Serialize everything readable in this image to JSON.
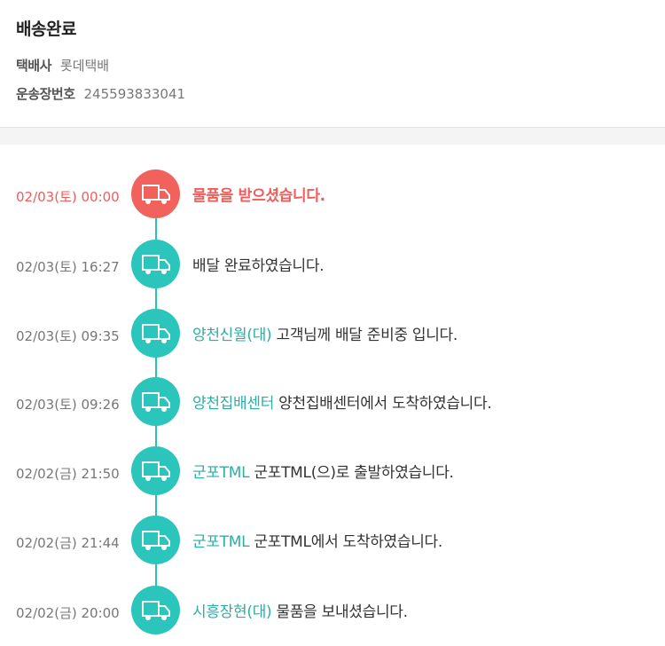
{
  "header": {
    "title": "배송완료",
    "courier_label": "택배사",
    "courier_value": "롯데택배",
    "tracking_label": "운송장번호",
    "tracking_value": "245593833041"
  },
  "colors": {
    "accent": "#2cc5bb",
    "highlight": "#f2625d"
  },
  "icon": "truck-icon",
  "events": [
    {
      "time": "02/03(토) 00:00",
      "location": "",
      "message": "물품을 받으셨습니다."
    },
    {
      "time": "02/03(토) 16:27",
      "location": "",
      "message": "배달 완료하였습니다."
    },
    {
      "time": "02/03(토) 09:35",
      "location": "양천신월(대)",
      "message": "고객님께 배달 준비중 입니다."
    },
    {
      "time": "02/03(토) 09:26",
      "location": "양천집배센터",
      "message": "양천집배센터에서 도착하였습니다."
    },
    {
      "time": "02/02(금) 21:50",
      "location": "군포TML",
      "message": "군포TML(으)로 출발하였습니다."
    },
    {
      "time": "02/02(금) 21:44",
      "location": "군포TML",
      "message": "군포TML에서 도착하였습니다."
    },
    {
      "time": "02/02(금) 20:00",
      "location": "시흥장현(대)",
      "message": "물품을 보내셨습니다."
    }
  ]
}
